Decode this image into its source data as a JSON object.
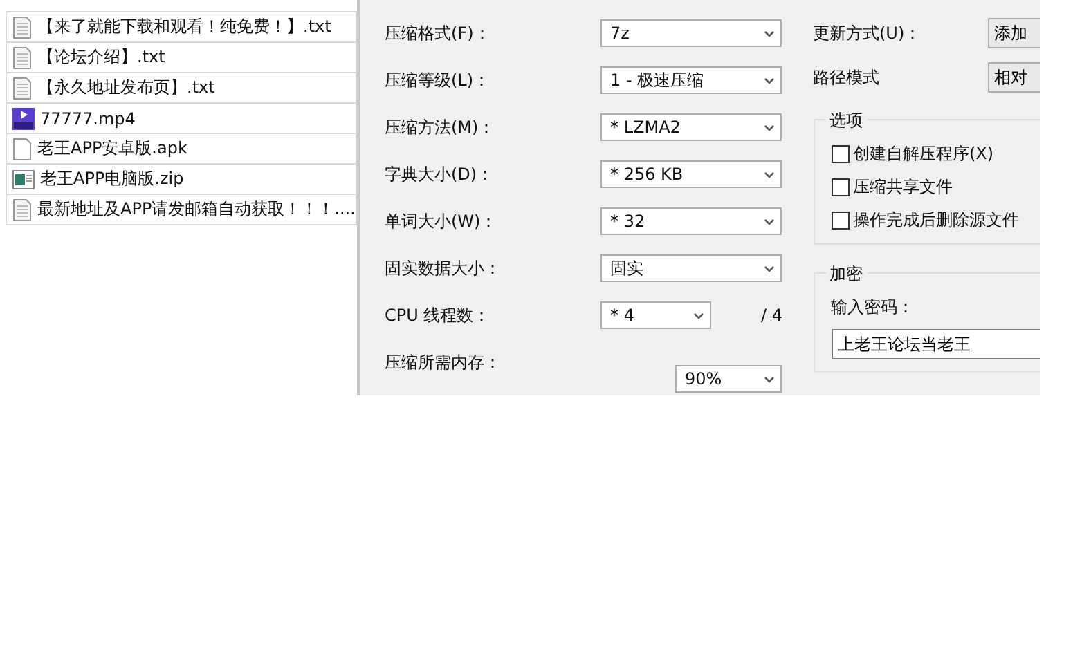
{
  "files": [
    {
      "name": "【来了就能下载和观看！纯免费！】.txt",
      "kind": "text"
    },
    {
      "name": "【论坛介绍】.txt",
      "kind": "text"
    },
    {
      "name": "【永久地址发布页】.txt",
      "kind": "text"
    },
    {
      "name": "77777.mp4",
      "kind": "video"
    },
    {
      "name": "老王APP安卓版.apk",
      "kind": "blank"
    },
    {
      "name": "老王APP电脑版.zip",
      "kind": "archive"
    },
    {
      "name": "最新地址及APP请发邮箱自动获取！！！....",
      "kind": "text"
    }
  ],
  "settings": [
    {
      "label": "压缩格式(F)：",
      "value": "7z"
    },
    {
      "label": "压缩等级(L)：",
      "value": "1 - 极速压缩"
    },
    {
      "label": "压缩方法(M)：",
      "value": "* LZMA2"
    },
    {
      "label": "字典大小(D)：",
      "value": "* 256 KB"
    },
    {
      "label": "单词大小(W)：",
      "value": "* 32"
    },
    {
      "label": "固实数据大小：",
      "value": "固实"
    }
  ],
  "cpu": {
    "label": "CPU 线程数：",
    "value": "* 4",
    "total": "/ 4"
  },
  "memory": {
    "label": "压缩所需内存：",
    "value": "90%"
  },
  "update_mode": {
    "label": "更新方式(U)：",
    "value": "添加"
  },
  "path_mode": {
    "label": "路径模式",
    "value": "相对"
  },
  "options": {
    "title": "选项",
    "items": [
      {
        "label": "创建自解压程序(X)",
        "checked": false
      },
      {
        "label": "压缩共享文件",
        "checked": false
      },
      {
        "label": "操作完成后删除源文件",
        "checked": false
      }
    ]
  },
  "encryption": {
    "title": "加密",
    "password_label": "输入密码：",
    "password": "上老王论坛当老王"
  }
}
